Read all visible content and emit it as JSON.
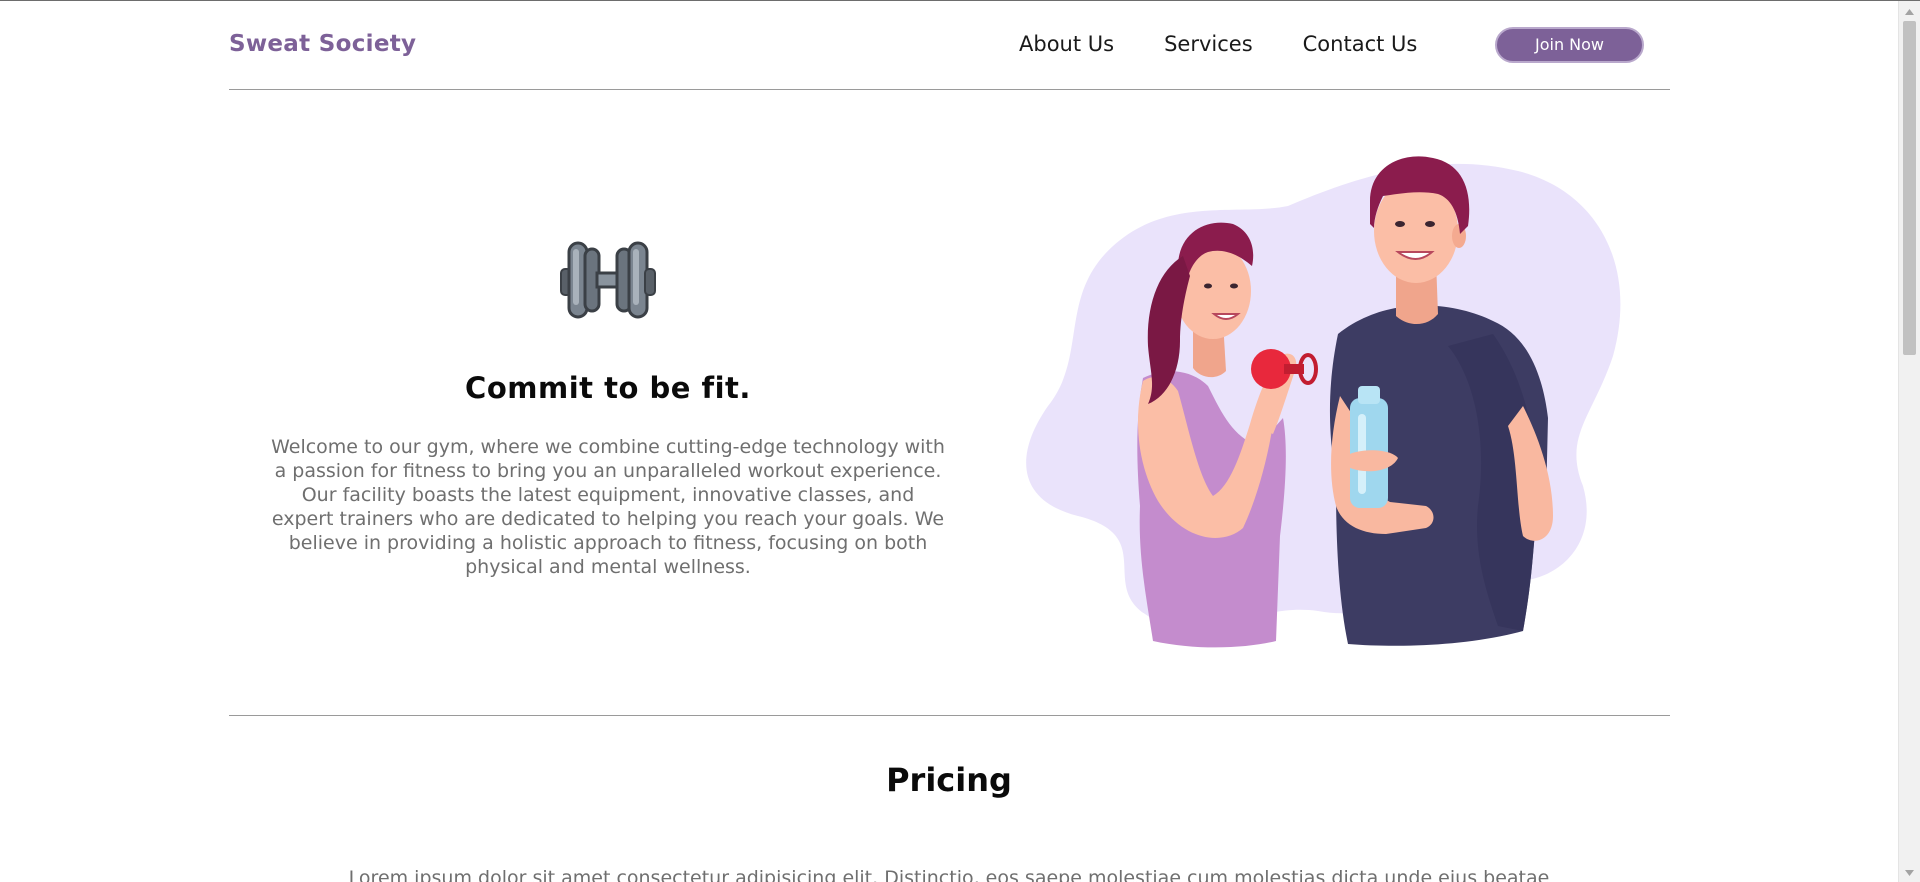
{
  "brand": {
    "name": "Sweat Society",
    "color": "#7d6198"
  },
  "nav": {
    "links": [
      {
        "label": "About Us"
      },
      {
        "label": "Services"
      },
      {
        "label": "Contact Us"
      }
    ],
    "cta_label": "Join Now"
  },
  "hero": {
    "icon": "dumbbell-icon",
    "title": "Commit to be fit.",
    "text": "Welcome to our gym, where we combine cutting-edge technology with a passion for fitness to bring you an unparalleled workout experience. Our facility boasts the latest equipment, innovative classes, and expert trainers who are dedicated to helping you reach your goals. We believe in providing a holistic approach to fitness, focusing on both physical and mental wellness.",
    "illustration": "couple-fitness-illustration"
  },
  "pricing": {
    "title": "Pricing",
    "text": "Lorem ipsum dolor sit amet consectetur adipisicing elit. Distinctio, eos saepe molestiae cum molestias dicta unde eius beatae officia a autem animi ducimus. Cum, sequi possimus sapiente iure voluptas a?"
  },
  "colors": {
    "accent": "#7d6198",
    "accent_light": "#eae3fb",
    "text_muted": "#6f6f6f"
  }
}
